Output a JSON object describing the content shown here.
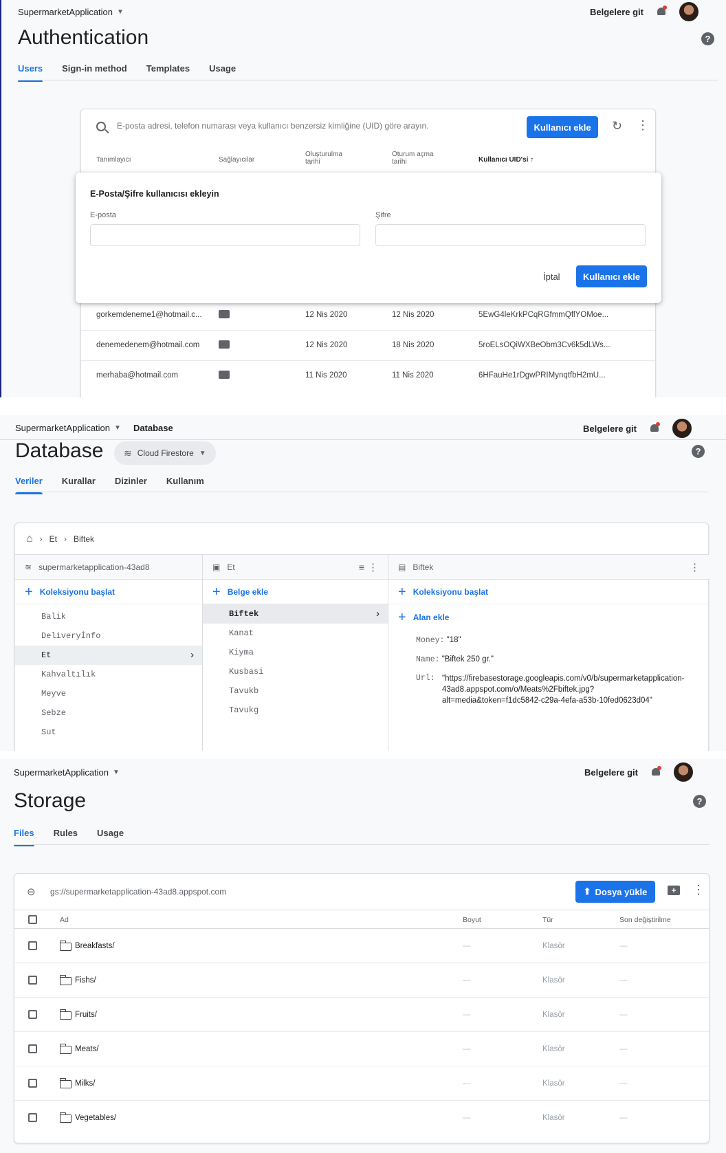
{
  "common": {
    "project": "SupermarketApplication",
    "docs_link": "Belgelere git"
  },
  "auth": {
    "title": "Authentication",
    "tabs": [
      "Users",
      "Sign-in method",
      "Templates",
      "Usage"
    ],
    "search_placeholder": "E-posta adresi, telefon numarası veya kullanıcı benzersiz kimliğine (UID) göre arayın.",
    "add_user_button": "Kullanıcı ekle",
    "columns": {
      "identifier": "Tanımlayıcı",
      "providers": "Sağlayıcılar",
      "created_1": "Oluşturulma",
      "created_2": "tarihi",
      "signin_1": "Oturum açma",
      "signin_2": "tarihi",
      "uid": "Kullanıcı UID'si"
    },
    "dialog": {
      "title": "E-Posta/Şifre kullanıcısı ekleyin",
      "email_label": "E-posta",
      "email_value": "",
      "password_label": "Şifre",
      "password_value": "",
      "cancel": "İptal",
      "submit": "Kullanıcı ekle"
    },
    "rows": [
      {
        "id": "gorkemdeneme1@hotmail.c...",
        "created": "12 Nis 2020",
        "signin": "12 Nis 2020",
        "uid": "5EwG4leKrkPCqRGfmmQflYOMoe..."
      },
      {
        "id": "denemedenem@hotmail.com",
        "created": "12 Nis 2020",
        "signin": "18 Nis 2020",
        "uid": "5roELsOQiWXBeObm3Cv6k5dLWs..."
      },
      {
        "id": "merhaba@hotmail.com",
        "created": "11 Nis 2020",
        "signin": "11 Nis 2020",
        "uid": "6HFauHe1rDgwPRIMynqtfbH2mU..."
      }
    ]
  },
  "db": {
    "breadcrumb_top": "Database",
    "title": "Database",
    "chip": "Cloud Firestore",
    "tabs": [
      "Veriler",
      "Kurallar",
      "Dizinler",
      "Kullanım"
    ],
    "path": [
      "Et",
      "Biftek"
    ],
    "col1_header": "supermarketapplication-43ad8",
    "col1_action": "Koleksiyonu başlat",
    "col1_items": [
      "Balik",
      "Deliveryİnfo",
      "Et",
      "Kahvaltılık",
      "Meyve",
      "Sebze",
      "Sut"
    ],
    "col2_header": "Et",
    "col2_action": "Belge ekle",
    "col2_items": [
      "Biftek",
      "Kanat",
      "Kiyma",
      "Kusbasi",
      "Tavukb",
      "Tavukg"
    ],
    "col3_header": "Biftek",
    "col3_action": "Koleksiyonu başlat",
    "col3_field_action": "Alan ekle",
    "fields": [
      {
        "key": "Money:",
        "value": "\"18\""
      },
      {
        "key": "Name:",
        "value": "\"Biftek 250 gr.\""
      },
      {
        "key": "Url:",
        "value_lines": [
          "\"https://firebasestorage.googleapis.com/v0/b/supermarketapplication-",
          "43ad8.appspot.com/o/Meats%2Fbiftek.jpg?",
          "alt=media&token=f1dc5842-c29a-4efa-a53b-10fed0623d04\""
        ]
      }
    ]
  },
  "storage": {
    "title": "Storage",
    "tabs": [
      "Files",
      "Rules",
      "Usage"
    ],
    "bucket": "gs://supermarketapplication-43ad8.appspot.com",
    "upload_button": "Dosya yükle",
    "columns": {
      "name": "Ad",
      "size": "Boyut",
      "type": "Tür",
      "modified": "Son değiştirilme"
    },
    "rows": [
      {
        "name": "Breakfasts/",
        "size": "—",
        "type": "Klasör",
        "modified": "—"
      },
      {
        "name": "Fishs/",
        "size": "—",
        "type": "Klasör",
        "modified": "—"
      },
      {
        "name": "Fruits/",
        "size": "—",
        "type": "Klasör",
        "modified": "—"
      },
      {
        "name": "Meats/",
        "size": "—",
        "type": "Klasör",
        "modified": "—"
      },
      {
        "name": "Milks/",
        "size": "—",
        "type": "Klasör",
        "modified": "—"
      },
      {
        "name": "Vegetables/",
        "size": "—",
        "type": "Klasör",
        "modified": "—"
      }
    ]
  }
}
